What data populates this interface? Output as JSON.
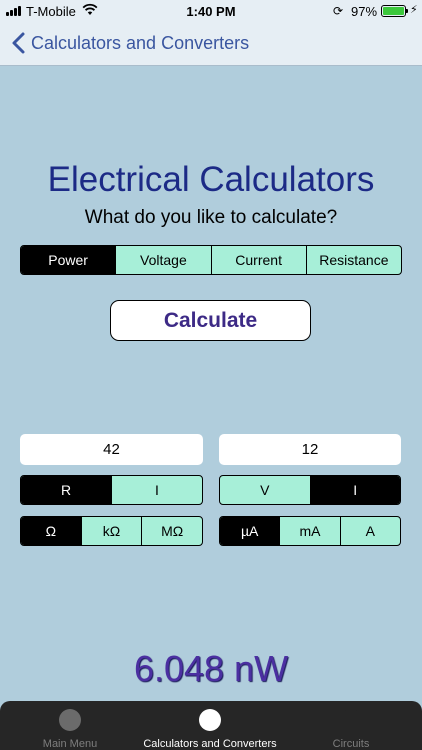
{
  "status_bar": {
    "carrier": "T-Mobile",
    "time": "1:40 PM",
    "battery": "97%"
  },
  "nav": {
    "back_label": "Calculators and Converters"
  },
  "main": {
    "title": "Electrical Calculators",
    "subtitle": "What do you like to calculate?",
    "modes": [
      "Power",
      "Voltage",
      "Current",
      "Resistance"
    ],
    "selected_mode": "Power",
    "calculate_label": "Calculate"
  },
  "inputs": {
    "left": {
      "value": "42",
      "quantity_options": [
        "R",
        "I"
      ],
      "selected_quantity": "R",
      "unit_options": [
        "Ω",
        "kΩ",
        "MΩ"
      ],
      "selected_unit": "Ω"
    },
    "right": {
      "value": "12",
      "quantity_options": [
        "V",
        "I"
      ],
      "selected_quantity": "I",
      "unit_options": [
        "µA",
        "mA",
        "A"
      ],
      "selected_unit": "µA"
    }
  },
  "result": "6.048 nW",
  "tab_bar": {
    "items": [
      "Main Menu",
      "Calculators and Converters",
      "Circuits"
    ],
    "selected": "Calculators and Converters"
  },
  "colors": {
    "background": "#b0cddc",
    "segment_fill": "#a7efd8",
    "title": "#1c2a86",
    "result": "#4b2fa1",
    "nav_link": "#3a56a0"
  }
}
